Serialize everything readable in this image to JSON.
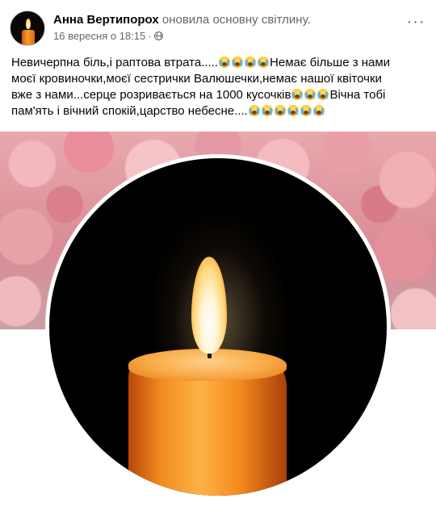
{
  "post": {
    "author_name": "Анна Вертипорох",
    "action_text": "оновила основну світлину.",
    "date": "16 вересня о 18:15",
    "separator": "·",
    "more_label": "···",
    "text_lines": [
      "Невичерпна біль,і раптова втрата.....",
      "Немає більше з нами",
      "моєї кровиночки,моєї сестрички Валюшечки,немає нашої квіточки",
      "вже з нами...серце розривається на 1000 кусочків",
      "Вічна тобі",
      "пам'ять і вічний спокій,царство небесне...."
    ]
  },
  "icons": {
    "privacy": "globe-icon",
    "more": "more-options-icon",
    "emoji": "crying-face-emoji"
  },
  "photo": {
    "subject": "lit candle profile picture"
  }
}
